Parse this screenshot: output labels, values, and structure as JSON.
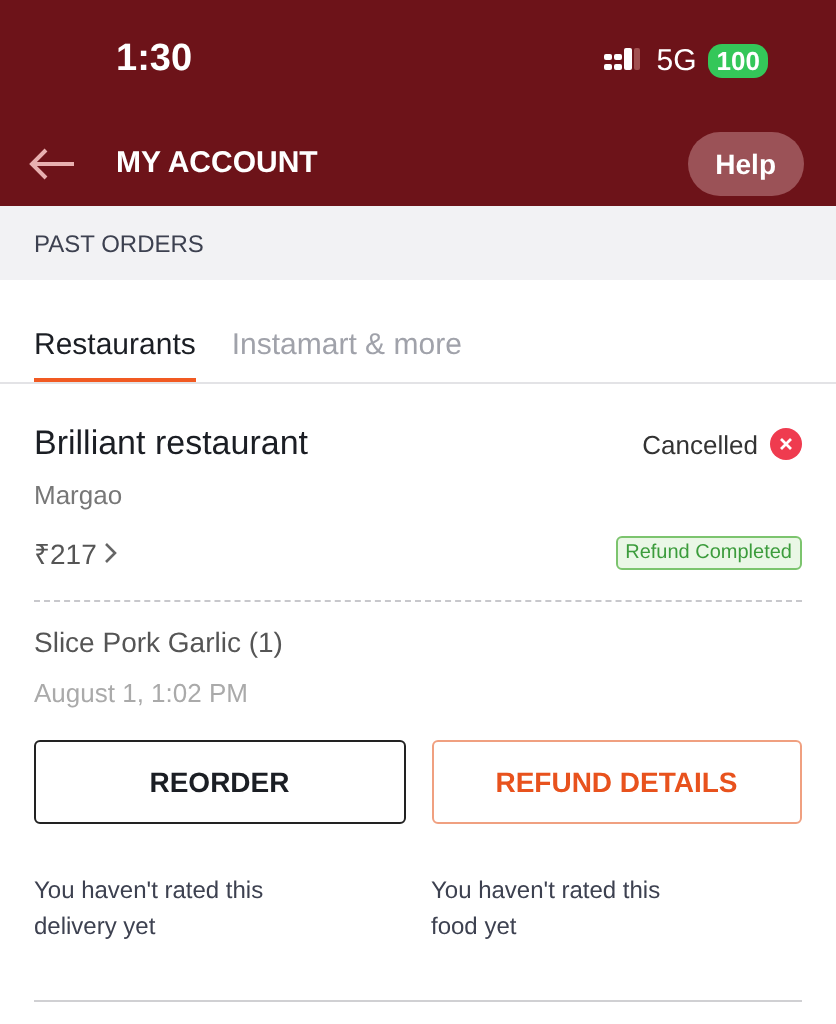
{
  "status_bar": {
    "time": "1:30",
    "network": "5G",
    "battery": "100"
  },
  "header": {
    "title": "MY ACCOUNT",
    "help_button": "Help"
  },
  "section_title": "PAST ORDERS",
  "tabs": [
    {
      "label": "Restaurants",
      "selected": true
    },
    {
      "label": "Instamart & more",
      "selected": false
    }
  ],
  "order": {
    "restaurant": "Brilliant restaurant",
    "status": "Cancelled",
    "location": "Margao",
    "amount": "₹217",
    "refund_badge": "Refund Completed",
    "items": "Slice Pork Garlic (1)",
    "date": "August 1, 1:02 PM",
    "buttons": [
      {
        "label": "REORDER",
        "kind": "dark"
      },
      {
        "label": "REFUND DETAILS",
        "kind": "accent"
      }
    ],
    "ratings": [
      "You haven't rated this delivery yet",
      "You haven't rated this food yet"
    ]
  }
}
